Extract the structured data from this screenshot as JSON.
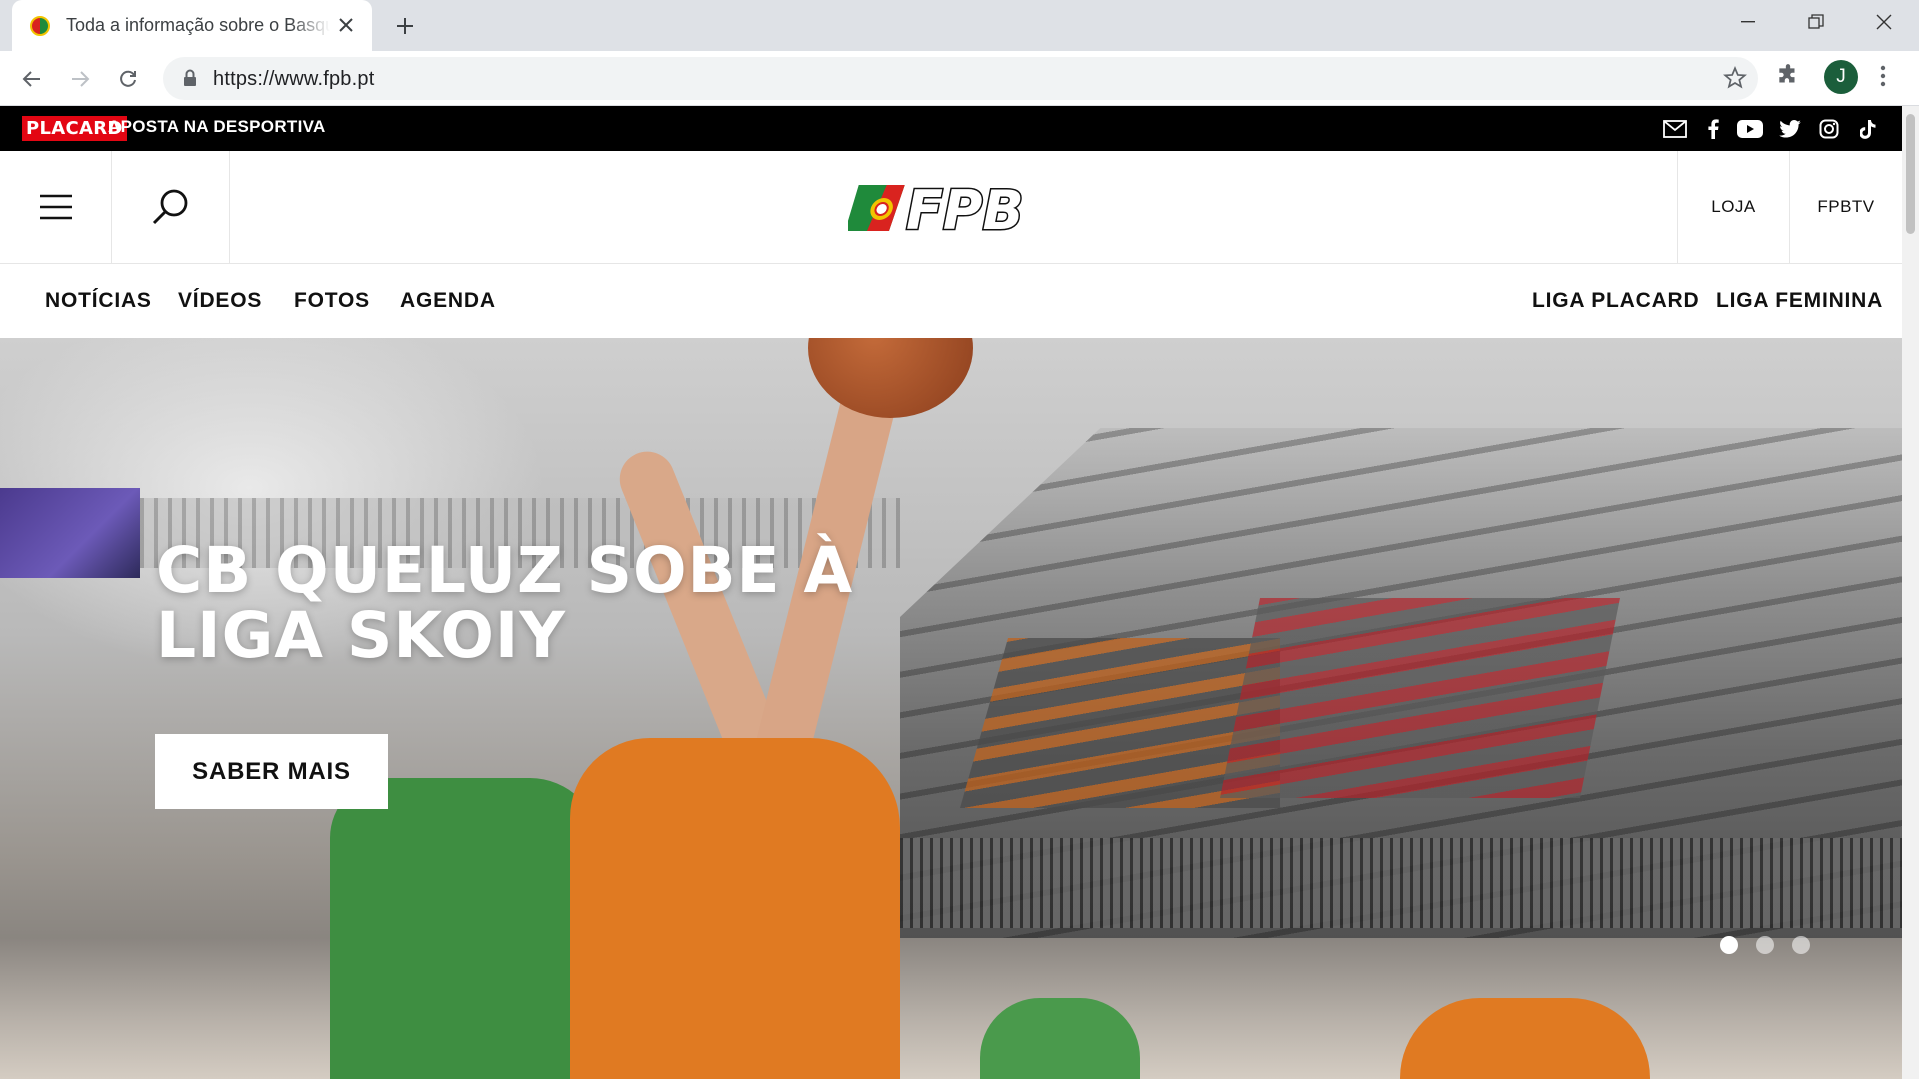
{
  "browser": {
    "tab_title": "Toda a informação sobre o Basquetebol",
    "url": "https://www.fpb.pt",
    "profile_initial": "J"
  },
  "topbar": {
    "brand": "PLACARD",
    "tagline": "APOSTA NA DESPORTIVA",
    "social_icons": [
      "mail-icon",
      "facebook-icon",
      "youtube-icon",
      "twitter-icon",
      "instagram-icon",
      "tiktok-icon"
    ]
  },
  "header": {
    "logo_text": "FPB",
    "links": [
      "LOJA",
      "FPBTV"
    ]
  },
  "nav": {
    "left": [
      "NOTÍCIAS",
      "VÍDEOS",
      "FOTOS",
      "AGENDA"
    ],
    "right": [
      "LIGA PLACARD",
      "LIGA FEMININA"
    ]
  },
  "hero": {
    "title": "CB QUELUZ SOBE À LIGA SKOIY",
    "button": "SABER MAIS",
    "slides": 3,
    "active_slide": 1
  },
  "colors": {
    "brand_red": "#e30613",
    "brand_green": "#1f8a3b",
    "chrome_bg": "#dee1e6",
    "top_strip": "#000000"
  }
}
